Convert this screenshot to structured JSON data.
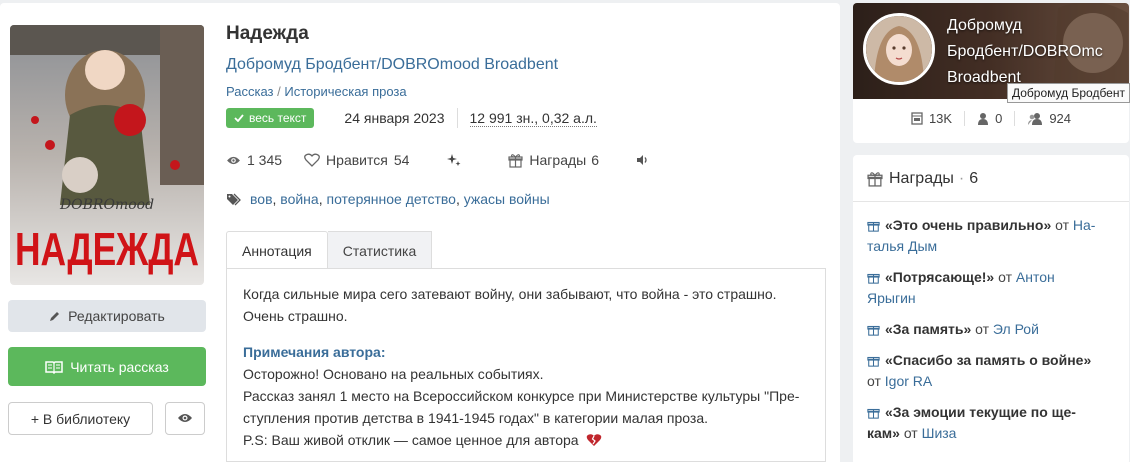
{
  "work": {
    "title": "Надежда",
    "author": "Добромуд Бродбент/DOBROmood Broadbent",
    "genre_primary": "Рассказ",
    "genre_sep": " / ",
    "genre_secondary": "Историческая проза",
    "badge": "весь текст",
    "date": "24 января 2023",
    "chars": "12 991 зн., 0,32 а.л.",
    "cover_text_top": "DOBROmood",
    "cover_text_title": "НАДЕЖДА"
  },
  "stats": {
    "views": "1 345",
    "likes_label": "Нравится",
    "likes_count": "54",
    "awards_label": "Награды",
    "awards_count": "6"
  },
  "tags": [
    {
      "label": "вов",
      "sep": ", "
    },
    {
      "label": "война",
      "sep": ", "
    },
    {
      "label": "потерянное детство",
      "sep": ", "
    },
    {
      "label": "ужасы войны",
      "sep": ""
    }
  ],
  "buttons": {
    "edit": "Редактировать",
    "read": "Читать рассказ",
    "library": "+ В библиотеку"
  },
  "tabs": {
    "annotation": "Аннотация",
    "statistics": "Статистика"
  },
  "annotation": {
    "line1": "Когда сильные мира сего затевают войну, они забывают, что война - это страшно.",
    "line2": "Очень страшно.",
    "notes_heading": "Примечания автора:",
    "note1": "Осторожно! Основано на реальных событиях.",
    "note2": "Рассказ занял 1 место на Всероссийском конкурсе при Министерстве культуры \"Пре-",
    "note3": "ступления против детства в 1941-1945 годах\" в категории малая проза.",
    "note4": "P.S: Ваш живой отклик — самое ценное для автора"
  },
  "author_card": {
    "name_line1": "Добромуд",
    "name_line2": "Бродбент/DOBROmc",
    "name_line3": "Broadbent",
    "tooltip": "Добромуд Бродбент",
    "works": "13K",
    "following": "0",
    "followers": "924"
  },
  "awards": {
    "title": "Награды",
    "count": "6",
    "items": [
      {
        "line1_bold": "«Это очень правильно»",
        "line1_from": " от ",
        "line1_user": "На-",
        "line2_user": "талья Дым"
      },
      {
        "line1_bold": "«Потрясающе!»",
        "line1_from": " от ",
        "line1_user": "Антон",
        "line2_user": "Ярыгин"
      },
      {
        "line1_bold": "«За память»",
        "line1_from": " от ",
        "line1_user": "Эл Рой"
      },
      {
        "line1_bold": "«Спасибо за память о войне»",
        "line2_from": "от ",
        "line2_user": "Igor RA"
      },
      {
        "line1_bold": "«За эмоции текущие по ще-",
        "line2_bold": "кам»",
        "line2_from": " от ",
        "line2_user": "Шиза"
      }
    ]
  },
  "colors": {
    "accent_link": "#3a6d99",
    "green": "#5cb85c"
  }
}
